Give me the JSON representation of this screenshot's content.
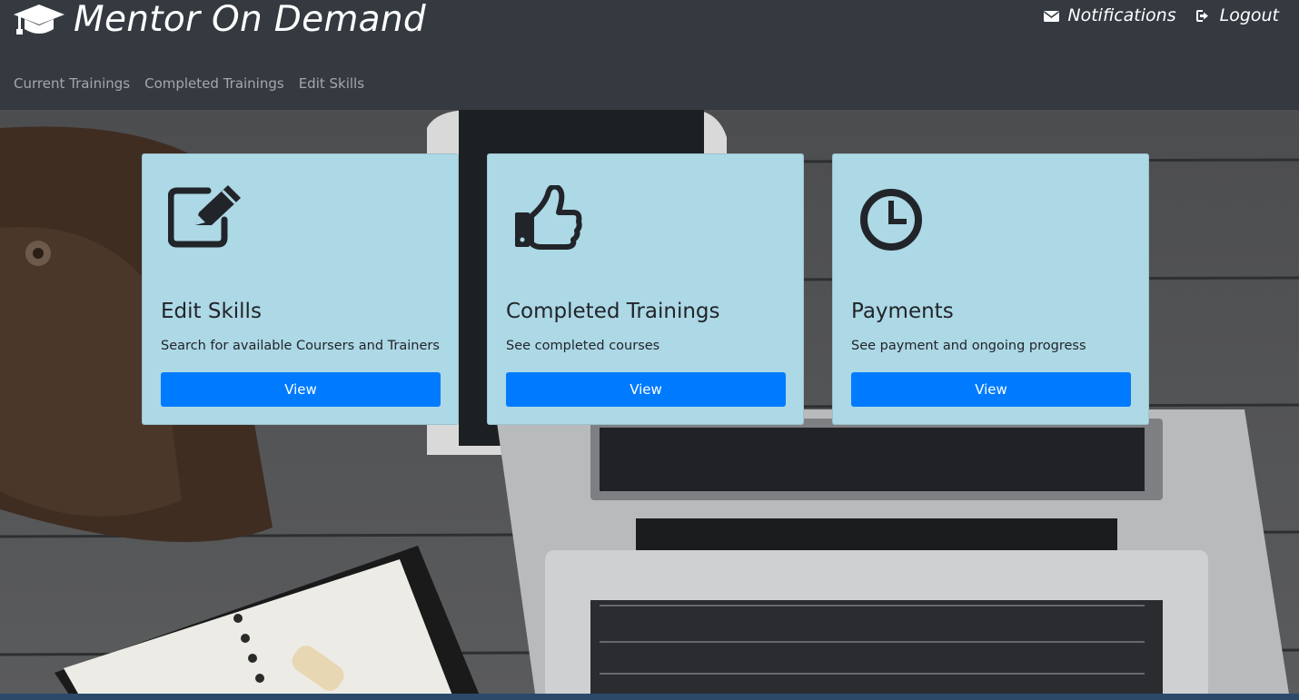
{
  "header": {
    "brand_title": "Mentor On Demand",
    "brand_icon": "graduation-cap-icon",
    "notifications_label": "Notifications",
    "logout_label": "Logout",
    "nav": [
      "Current Trainings",
      "Completed Trainings",
      "Edit Skills"
    ]
  },
  "cards": [
    {
      "icon": "edit-icon",
      "title": "Edit Skills",
      "text": "Search for available Coursers and Trainers",
      "button": "View"
    },
    {
      "icon": "thumbs-up-icon",
      "title": "Completed Trainings",
      "text": "See completed courses",
      "button": "View"
    },
    {
      "icon": "clock-icon",
      "title": "Payments",
      "text": "See payment and ongoing progress",
      "button": "View"
    }
  ],
  "colors": {
    "header_bg": "#343a40",
    "card_bg": "#add8e6",
    "button_bg": "#007bff"
  }
}
